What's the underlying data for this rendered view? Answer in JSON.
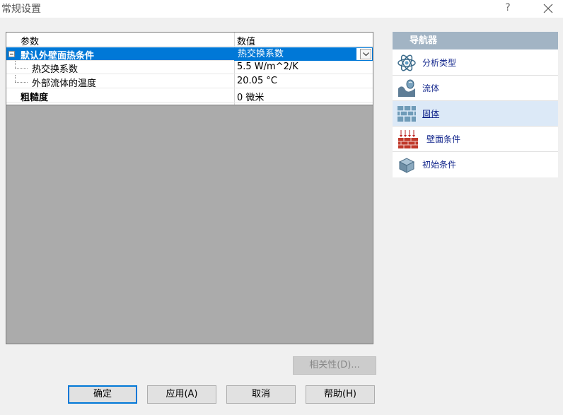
{
  "window": {
    "title": "常规设置",
    "help_glyph": "?"
  },
  "grid": {
    "columns": {
      "param": "参数",
      "value": "数值"
    },
    "selected_row": {
      "name": "默认外壁面热条件",
      "value": "热交换系数"
    },
    "rows": [
      {
        "name": "热交换系数",
        "value": "5.5 W/m^2/K"
      },
      {
        "name": "外部流体的温度",
        "value": "20.05 °C"
      },
      {
        "name": "粗糙度",
        "value": "0 微米"
      }
    ]
  },
  "navigator": {
    "title": "导航器",
    "items": [
      {
        "label": "分析类型",
        "icon": "atom-icon"
      },
      {
        "label": "流体",
        "icon": "fluid-icon"
      },
      {
        "label": "固体",
        "icon": "brick-wall-icon"
      },
      {
        "label": "壁面条件",
        "icon": "wall-heat-icon"
      },
      {
        "label": "初始条件",
        "icon": "cube-icon"
      }
    ]
  },
  "buttons": {
    "dependency": "相关性(D)...",
    "ok": "确定",
    "apply": "应用(A)",
    "cancel": "取消",
    "help": "帮助(H)"
  },
  "colors": {
    "selection": "#0078d7",
    "nav_header": "#a2b4c4",
    "nav_selected": "#dce9f7",
    "empty_grid": "#ababab"
  }
}
